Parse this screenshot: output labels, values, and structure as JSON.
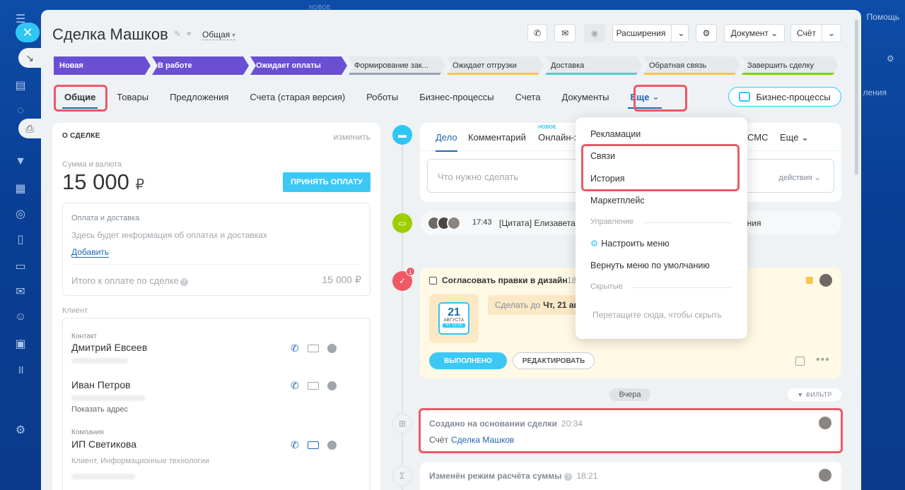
{
  "top_new_badge": "НОВОЕ",
  "help_label": "Помощь",
  "right_partial_label": "ления",
  "deal": {
    "title": "Сделка Машков",
    "category": "Общая"
  },
  "toolbar": {
    "extensions": "Расширения",
    "document": "Документ",
    "invoice": "Счёт"
  },
  "stages": [
    {
      "label": "Новая",
      "state": "active"
    },
    {
      "label": "В работе",
      "state": "active"
    },
    {
      "label": "Ожидает оплаты",
      "state": "active"
    },
    {
      "label": "Формирование зак...",
      "state": "todo",
      "color": "#9aa3ab"
    },
    {
      "label": "Ожидает отгрузки",
      "state": "todo",
      "color": "#f7c64a"
    },
    {
      "label": "Доставка",
      "state": "todo",
      "color": "#4fd1c5"
    },
    {
      "label": "Обратная связь",
      "state": "todo",
      "color": "#f7c64a"
    },
    {
      "label": "Завершить сделку",
      "state": "todo",
      "color": "#7bd500"
    }
  ],
  "tabs": [
    {
      "label": "Общие",
      "selected": true
    },
    {
      "label": "Товары"
    },
    {
      "label": "Предложения"
    },
    {
      "label": "Счета (старая версия)"
    },
    {
      "label": "Роботы"
    },
    {
      "label": "Бизнес-процессы"
    },
    {
      "label": "Счета"
    },
    {
      "label": "Документы"
    },
    {
      "label": "Еще"
    }
  ],
  "bp_button": "Бизнес-процессы",
  "about": {
    "header": "О СДЕЛКЕ",
    "edit": "изменить",
    "sum_label": "Сумма и валюта",
    "amount": "15 000",
    "currency": "₽",
    "pay_button": "ПРИНЯТЬ ОПЛАТУ",
    "payment_title": "Оплата и доставка",
    "payment_info": "Здесь будет информация об оплатах и доставках",
    "add": "Добавить",
    "total_label": "Итого к оплате по сделке",
    "total_value": "15 000 ₽",
    "client_label": "Клиент",
    "contact_label": "Контакт",
    "contact1": "Дмитрий Евсеев",
    "contact2": "Иван Петров",
    "show_address": "Показать адрес",
    "company_label": "Компания",
    "company": "ИП Светикова",
    "company_sub": "Клиент, Информационные технологии"
  },
  "editor": {
    "tab_task": "Дело",
    "tab_comment": "Комментарий",
    "tab_online": "Онлайн-з",
    "new_badge": "НОВОЕ",
    "tab_sms": "СМС",
    "tab_more": "Еще",
    "placeholder": "Что нужно сделать",
    "actions": "действия"
  },
  "comment_row": {
    "time": "17:43",
    "text": "[Цитата] Елизавета"
  },
  "task": {
    "badge": "1",
    "title": "Согласовать правки в дизайн",
    "partial": "18",
    "cal_day": "21",
    "cal_month": "АВГУСТА",
    "cal_time": "ЧТ 15:00",
    "deadline_label": "Сделать до",
    "deadline_value": "Чт, 21 авг",
    "done": "ВЫПОЛНЕНО",
    "edit": "РЕДАКТИРОВАТЬ"
  },
  "divider": {
    "yesterday": "Вчера",
    "filter": "ФИЛЬТР"
  },
  "event1": {
    "title": "Создано на основании сделки",
    "time": "20:34",
    "prefix": "Счёт",
    "link": "Сделка Машков"
  },
  "event2": {
    "title": "Изменён режим расчёта суммы",
    "time": "18:21"
  },
  "menu": {
    "items_top": [
      "Рекламации",
      "Связи",
      "История",
      "Маркетплейс"
    ],
    "section_manage": "Управление",
    "configure": "Настроить меню",
    "reset": "Вернуть меню по умолчанию",
    "section_hidden": "Скрытые",
    "drop_hint": "Перетащите сюда, чтобы скрыть"
  }
}
